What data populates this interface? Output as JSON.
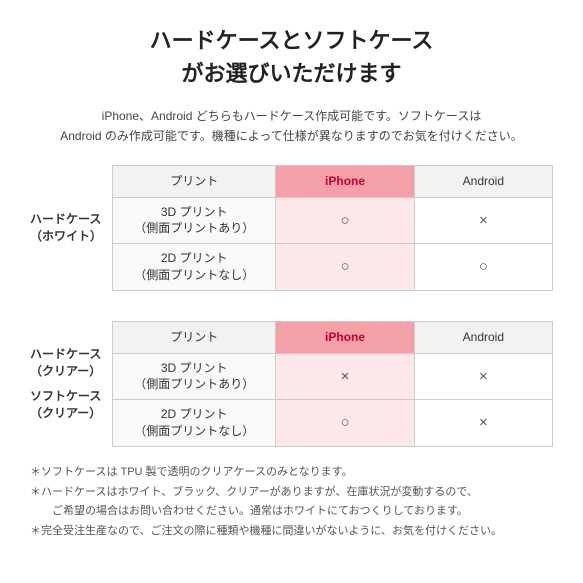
{
  "title_line1": "ハードケースとソフトケース",
  "title_line2": "がお選びいただけます",
  "subtitle": "iPhone、Android どちらもハードケース作成可能です。ソフトケースは\nAndroid のみ作成可能です。機種によって仕様が異なりますのでお気を付けください。",
  "table1": {
    "section_label": "ハードケース\n（ホワイト）",
    "col_print": "プリント",
    "col_iphone": "iPhone",
    "col_android": "Android",
    "rows": [
      {
        "label": "3D プリント\n（側面プリントあり）",
        "iphone": "○",
        "android": "×"
      },
      {
        "label": "2D プリント\n（側面プリントなし）",
        "iphone": "○",
        "android": "○"
      }
    ]
  },
  "table2": {
    "section_label1": "ハードケース\n（クリアー）",
    "section_label2": "ソフトケース\n（クリアー）",
    "col_print": "プリント",
    "col_iphone": "iPhone",
    "col_android": "Android",
    "rows": [
      {
        "label": "3D プリント\n（側面プリントあり）",
        "iphone": "×",
        "android": "×"
      },
      {
        "label": "2D プリント\n（側面プリントなし）",
        "iphone": "○",
        "android": "×"
      }
    ]
  },
  "notes": [
    "＊ソフトケースは TPU 製で透明のクリアケースのみとなります。",
    "＊ハードケースはホワイト、ブラック、クリアーがありますが、在庫状況が変動するので、　ご希望の場合はお問い合わせください。通常はホワイトにておつくりしております。",
    "＊完全受注生産なので、ご注文の際に種類や機種に間違いがないように、お気を付けください。"
  ]
}
